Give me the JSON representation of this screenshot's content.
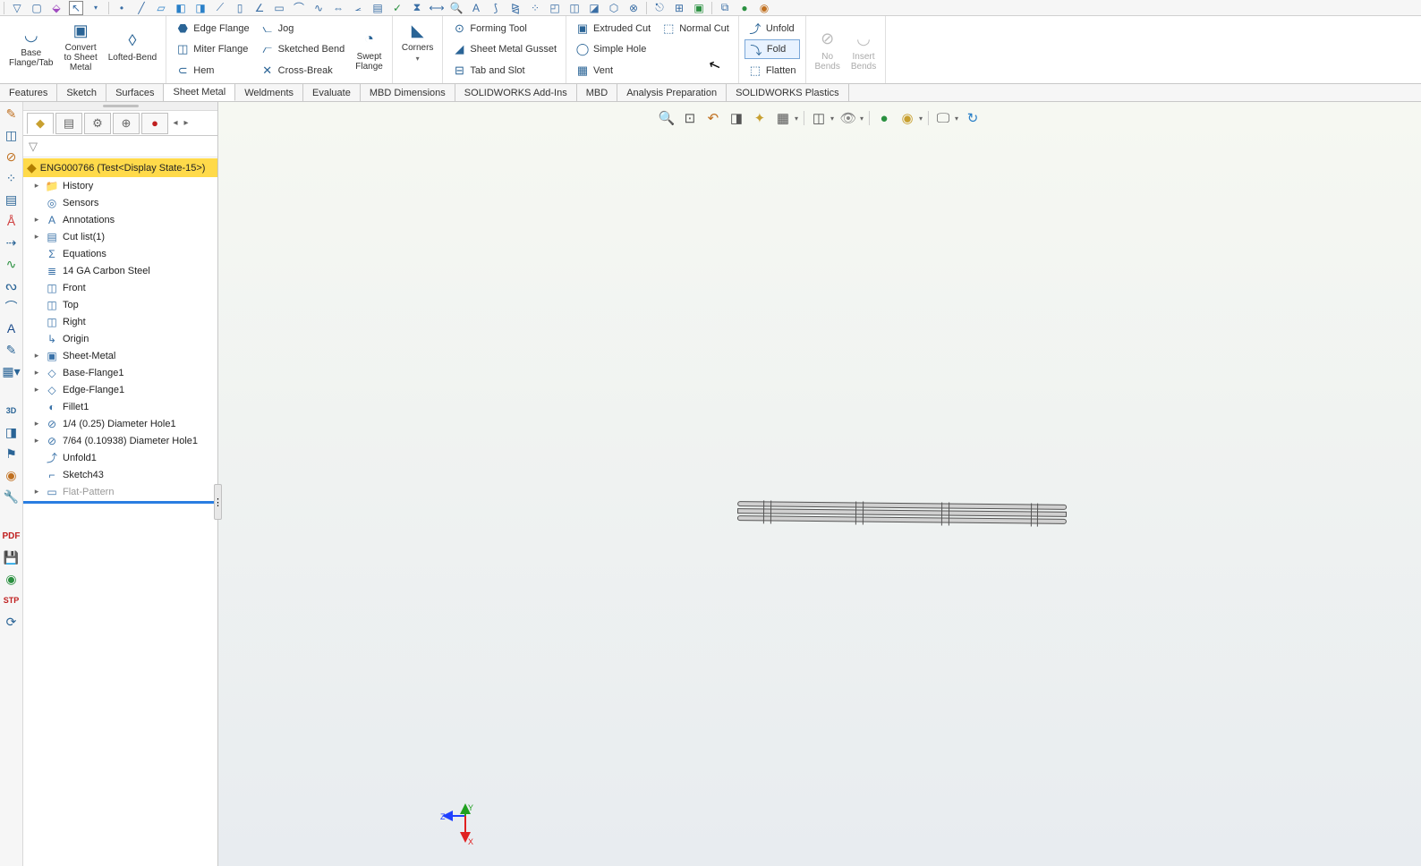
{
  "ribbon": {
    "big": {
      "base_flange": "Base\nFlange/Tab",
      "convert": "Convert\nto Sheet\nMetal",
      "lofted": "Lofted-Bend",
      "swept": "Swept\nFlange",
      "corners": "Corners",
      "no_bends": "No\nBends",
      "insert_bends": "Insert\nBends"
    },
    "col1": {
      "edge_flange": "Edge Flange",
      "miter_flange": "Miter Flange",
      "hem": "Hem"
    },
    "col2": {
      "jog": "Jog",
      "sketched_bend": "Sketched Bend",
      "cross_break": "Cross-Break"
    },
    "col3": {
      "forming_tool": "Forming Tool",
      "sheet_gusset": "Sheet Metal Gusset",
      "tab_slot": "Tab and Slot"
    },
    "col4": {
      "extruded_cut": "Extruded Cut",
      "simple_hole": "Simple Hole",
      "vent": "Vent"
    },
    "col5": {
      "normal_cut": "Normal Cut"
    },
    "col6": {
      "unfold": "Unfold",
      "fold": "Fold",
      "flatten": "Flatten"
    }
  },
  "tabs": [
    "Features",
    "Sketch",
    "Surfaces",
    "Sheet Metal",
    "Weldments",
    "Evaluate",
    "MBD Dimensions",
    "SOLIDWORKS Add-Ins",
    "MBD",
    "Analysis Preparation",
    "SOLIDWORKS Plastics"
  ],
  "active_tab": 3,
  "fm": {
    "root": "ENG000766  (Test<Display State-15>)",
    "nodes": [
      {
        "exp": true,
        "icon": "📁",
        "label": "History"
      },
      {
        "exp": false,
        "icon": "◎",
        "label": "Sensors"
      },
      {
        "exp": true,
        "icon": "A",
        "label": "Annotations"
      },
      {
        "exp": true,
        "icon": "▤",
        "label": "Cut list(1)"
      },
      {
        "exp": false,
        "icon": "Σ",
        "label": "Equations"
      },
      {
        "exp": false,
        "icon": "≣",
        "label": "14 GA Carbon Steel"
      },
      {
        "exp": false,
        "icon": "◫",
        "label": "Front"
      },
      {
        "exp": false,
        "icon": "◫",
        "label": "Top"
      },
      {
        "exp": false,
        "icon": "◫",
        "label": "Right"
      },
      {
        "exp": false,
        "icon": "↳",
        "label": "Origin"
      },
      {
        "exp": true,
        "icon": "▣",
        "label": "Sheet-Metal"
      },
      {
        "exp": true,
        "icon": "◇",
        "label": "Base-Flange1"
      },
      {
        "exp": true,
        "icon": "◇",
        "label": "Edge-Flange1"
      },
      {
        "exp": false,
        "icon": "◐",
        "label": "Fillet1"
      },
      {
        "exp": true,
        "icon": "⊘",
        "label": "1/4 (0.25) Diameter Hole1"
      },
      {
        "exp": true,
        "icon": "⊘",
        "label": "7/64 (0.10938) Diameter Hole1"
      },
      {
        "exp": false,
        "icon": "⤴",
        "label": "Unfold1"
      },
      {
        "exp": false,
        "icon": "⌐",
        "label": "Sketch43"
      },
      {
        "exp": true,
        "icon": "▭",
        "label": "Flat-Pattern",
        "grey": true
      }
    ]
  },
  "triad": {
    "x": "X",
    "y": "Y",
    "z": "Z"
  }
}
